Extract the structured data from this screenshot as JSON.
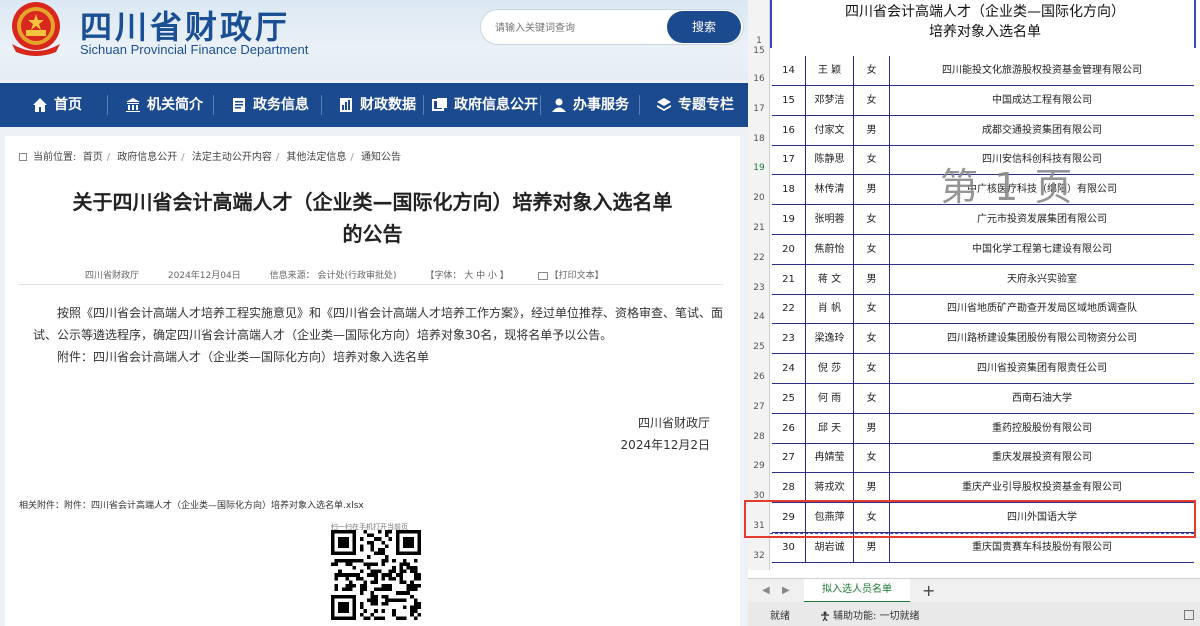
{
  "web": {
    "site_title": "四川省财政厅",
    "site_subtitle": "Sichuan Provincial Finance Department",
    "search": {
      "placeholder": "请输入关键词查询",
      "button": "搜索"
    },
    "nav": [
      "首页",
      "机关简介",
      "政务信息",
      "财政数据",
      "政府信息公开",
      "办事服务",
      "专题专栏"
    ],
    "breadcrumb": {
      "label": "当前位置:",
      "items": [
        "首页",
        "政府信息公开",
        "法定主动公开内容",
        "其他法定信息",
        "通知公告"
      ]
    },
    "article": {
      "title_line1": "关于四川省会计高端人才（企业类—国际化方向）培养对象入选名单",
      "title_line2": "的公告",
      "meta_source": "四川省财政厅",
      "meta_date": "2024年12月04日",
      "meta_info_source": "信息来源： 会计处(行政审批处)",
      "meta_font": "【字体： 大  中  小 】",
      "meta_print": "【打印文本】",
      "paragraph1": "按照《四川省会计高端人才培养工程实施意见》和《四川省会计高端人才培养工作方案》，经过单位推荐、资格审查、笔试、面试、公示等遴选程序，确定四川省会计高端人才（企业类—国际化方向）培养对象30名，现将名单予以公告。",
      "paragraph2": "附件：四川省会计高端人才（企业类—国际化方向）培养对象入选名单",
      "signature": "四川省财政厅",
      "signature_date": "2024年12月2日",
      "attachment": "相关附件：附件：四川省会计高端人才（企业类—国际化方向）培养对象入选名单.xlsx",
      "qr_caption": "扫一扫在手机打开当前页"
    }
  },
  "sheet": {
    "title_line1": "四川省会计高端人才（企业类—国际化方向）",
    "title_line2": "培养对象入选名单",
    "watermark": "第 1 页",
    "row_numbers": [
      "1",
      "15",
      "16",
      "17",
      "18",
      "19",
      "20",
      "21",
      "22",
      "23",
      "24",
      "25",
      "26",
      "27",
      "28",
      "29",
      "30",
      "31",
      "32"
    ],
    "rows": [
      {
        "no": "14",
        "name": "王  颖",
        "gender": "女",
        "org": "四川能投文化旅游股权投资基金管理有限公司"
      },
      {
        "no": "15",
        "name": "邓梦洁",
        "gender": "女",
        "org": "中国成达工程有限公司"
      },
      {
        "no": "16",
        "name": "付家文",
        "gender": "男",
        "org": "成都交通投资集团有限公司"
      },
      {
        "no": "17",
        "name": "陈静思",
        "gender": "女",
        "org": "四川安信科创科技有限公司"
      },
      {
        "no": "18",
        "name": "林传清",
        "gender": "男",
        "org": "中广核医疗科技（绵阳）有限公司"
      },
      {
        "no": "19",
        "name": "张明蓉",
        "gender": "女",
        "org": "广元市投资发展集团有限公司"
      },
      {
        "no": "20",
        "name": "焦蔚怡",
        "gender": "女",
        "org": "中国化学工程第七建设有限公司"
      },
      {
        "no": "21",
        "name": "蒋  文",
        "gender": "男",
        "org": "天府永兴实验室"
      },
      {
        "no": "22",
        "name": "肖  帆",
        "gender": "女",
        "org": "四川省地质矿产勘查开发局区域地质调查队"
      },
      {
        "no": "23",
        "name": "梁逸玲",
        "gender": "女",
        "org": "四川路桥建设集团股份有限公司物资分公司"
      },
      {
        "no": "24",
        "name": "倪  莎",
        "gender": "女",
        "org": "四川省投资集团有限责任公司"
      },
      {
        "no": "25",
        "name": "何  雨",
        "gender": "女",
        "org": "西南石油大学"
      },
      {
        "no": "26",
        "name": "邱  天",
        "gender": "男",
        "org": "重药控股股份有限公司"
      },
      {
        "no": "27",
        "name": "冉婧莹",
        "gender": "女",
        "org": "重庆发展投资有限公司"
      },
      {
        "no": "28",
        "name": "蒋戎欢",
        "gender": "男",
        "org": "重庆产业引导股权投资基金有限公司"
      },
      {
        "no": "29",
        "name": "包燕萍",
        "gender": "女",
        "org": "四川外国语大学"
      },
      {
        "no": "30",
        "name": "胡岩诚",
        "gender": "男",
        "org": "重庆国贵赛车科技股份有限公司"
      }
    ],
    "tab_name": "拟入选人员名单",
    "add_tab": "+",
    "status_ready": "就绪",
    "status_accessibility": "辅助功能: 一切就绪",
    "colors": {
      "grid": "#2a2f8a",
      "highlight": "#e53b2e",
      "nav": "#1c4a8f"
    }
  }
}
